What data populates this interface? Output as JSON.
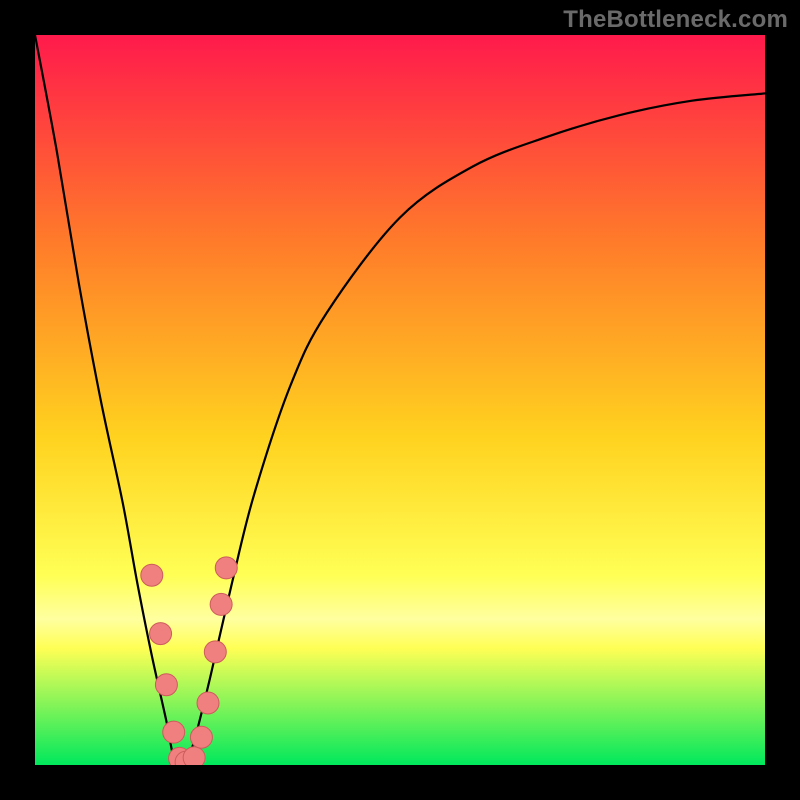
{
  "watermark": "TheBottleneck.com",
  "colors": {
    "frame": "#000000",
    "gradient_top": "#ff1a4c",
    "gradient_mid1": "#ff7a2a",
    "gradient_mid2": "#ffd21f",
    "gradient_mid3": "#ffff55",
    "gradient_band": "#ffffa0",
    "gradient_bottom": "#00e85c",
    "curve": "#000000",
    "dot_fill": "#f08080",
    "dot_stroke": "#cc5c5c"
  },
  "chart_data": {
    "type": "line",
    "title": "",
    "xlabel": "",
    "ylabel": "",
    "xlim": [
      0,
      1
    ],
    "ylim": [
      0,
      100
    ],
    "series": [
      {
        "name": "bottleneck-curve",
        "x": [
          0.0,
          0.03,
          0.06,
          0.09,
          0.12,
          0.14,
          0.16,
          0.18,
          0.19,
          0.2,
          0.21,
          0.22,
          0.24,
          0.27,
          0.3,
          0.35,
          0.4,
          0.5,
          0.6,
          0.7,
          0.8,
          0.9,
          1.0
        ],
        "values": [
          100,
          84,
          66,
          50,
          36,
          25,
          15,
          6,
          1,
          0,
          1,
          4,
          12,
          25,
          37,
          52,
          62,
          75,
          82,
          86,
          89,
          91,
          92
        ]
      }
    ],
    "points": [
      {
        "x": 0.16,
        "y": 26.0
      },
      {
        "x": 0.172,
        "y": 18.0
      },
      {
        "x": 0.18,
        "y": 11.0
      },
      {
        "x": 0.19,
        "y": 4.5
      },
      {
        "x": 0.198,
        "y": 0.9
      },
      {
        "x": 0.207,
        "y": 0.4
      },
      {
        "x": 0.218,
        "y": 1.0
      },
      {
        "x": 0.228,
        "y": 3.8
      },
      {
        "x": 0.237,
        "y": 8.5
      },
      {
        "x": 0.247,
        "y": 15.5
      },
      {
        "x": 0.255,
        "y": 22.0
      },
      {
        "x": 0.262,
        "y": 27.0
      }
    ],
    "dot_radius": 11
  }
}
